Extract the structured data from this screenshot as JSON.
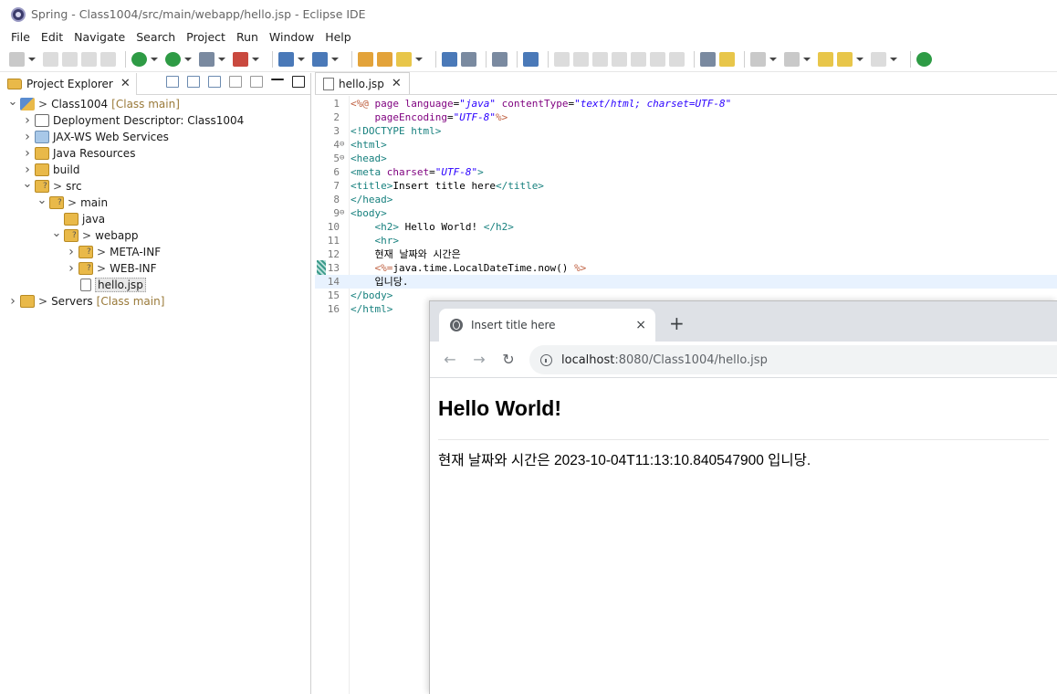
{
  "window": {
    "title": "Spring - Class1004/src/main/webapp/hello.jsp - Eclipse IDE"
  },
  "menu": [
    "File",
    "Edit",
    "Navigate",
    "Search",
    "Project",
    "Run",
    "Window",
    "Help"
  ],
  "explorer": {
    "tab_label": "Project Explorer",
    "tree": [
      {
        "depth": 0,
        "chevron": "down",
        "icon": "project",
        "prefix": ">",
        "label": "Class1004",
        "deco": "[Class main]"
      },
      {
        "depth": 1,
        "chevron": "right",
        "icon": "dd",
        "prefix": "",
        "label": "Deployment Descriptor: Class1004",
        "deco": ""
      },
      {
        "depth": 1,
        "chevron": "right",
        "icon": "ws",
        "prefix": "",
        "label": "JAX-WS Web Services",
        "deco": ""
      },
      {
        "depth": 1,
        "chevron": "right",
        "icon": "jr",
        "prefix": "",
        "label": "Java Resources",
        "deco": ""
      },
      {
        "depth": 1,
        "chevron": "right",
        "icon": "folder",
        "prefix": "",
        "label": "build",
        "deco": ""
      },
      {
        "depth": 1,
        "chevron": "down",
        "icon": "pkgfolder",
        "prefix": ">",
        "label": "src",
        "deco": ""
      },
      {
        "depth": 2,
        "chevron": "down",
        "icon": "pkgfolder",
        "prefix": ">",
        "label": "main",
        "deco": ""
      },
      {
        "depth": 3,
        "chevron": "",
        "icon": "folder",
        "prefix": "",
        "label": "java",
        "deco": ""
      },
      {
        "depth": 3,
        "chevron": "down",
        "icon": "pkgfolder",
        "prefix": ">",
        "label": "webapp",
        "deco": ""
      },
      {
        "depth": 4,
        "chevron": "right",
        "icon": "pkgfolder",
        "prefix": ">",
        "label": "META-INF",
        "deco": ""
      },
      {
        "depth": 4,
        "chevron": "right",
        "icon": "pkgfolder",
        "prefix": ">",
        "label": "WEB-INF",
        "deco": ""
      },
      {
        "depth": 4,
        "chevron": "",
        "icon": "file",
        "prefix": "",
        "label": "hello.jsp",
        "deco": "",
        "selected": true
      },
      {
        "depth": 0,
        "chevron": "right",
        "icon": "server",
        "prefix": ">",
        "label": "Servers",
        "deco": "[Class main]"
      }
    ]
  },
  "editor": {
    "tab_label": "hello.jsp",
    "current_line": 14,
    "lines": [
      {
        "n": "1",
        "fold": "",
        "html": "<span class=\"jsp\">&lt;%@</span> <span class=\"attr\">page</span> <span class=\"attr\">language</span>=<span class=\"str\">\"java\"</span> <span class=\"attr\">contentType</span>=<span class=\"str\">\"text/html; charset=UTF-8\"</span>"
      },
      {
        "n": "2",
        "fold": "",
        "html": "    <span class=\"attr\">pageEncoding</span>=<span class=\"str\">\"UTF-8\"</span><span class=\"jsp\">%&gt;</span>"
      },
      {
        "n": "3",
        "fold": "",
        "html": "<span class=\"tag\">&lt;!DOCTYPE html&gt;</span>"
      },
      {
        "n": "4",
        "fold": "⊖",
        "html": "<span class=\"tag\">&lt;html&gt;</span>"
      },
      {
        "n": "5",
        "fold": "⊖",
        "html": "<span class=\"tag\">&lt;head&gt;</span>"
      },
      {
        "n": "6",
        "fold": "",
        "html": "<span class=\"tag\">&lt;meta</span> <span class=\"attr\">charset</span>=<span class=\"str\">\"UTF-8\"</span><span class=\"tag\">&gt;</span>"
      },
      {
        "n": "7",
        "fold": "",
        "html": "<span class=\"tag\">&lt;title&gt;</span>Insert title here<span class=\"tag\">&lt;/title&gt;</span>"
      },
      {
        "n": "8",
        "fold": "",
        "html": "<span class=\"tag\">&lt;/head&gt;</span>"
      },
      {
        "n": "9",
        "fold": "⊖",
        "html": "<span class=\"tag\">&lt;body&gt;</span>"
      },
      {
        "n": "10",
        "fold": "",
        "html": "    <span class=\"tag\">&lt;h2&gt;</span> Hello World! <span class=\"tag\">&lt;/h2&gt;</span>"
      },
      {
        "n": "11",
        "fold": "",
        "html": "    <span class=\"tag\">&lt;hr&gt;</span>"
      },
      {
        "n": "12",
        "fold": "",
        "html": "    현재 날짜와 시간은"
      },
      {
        "n": "13",
        "fold": "",
        "html": "    <span class=\"jsp\">&lt;%=</span>java.time.LocalDateTime.now() <span class=\"jsp\">%&gt;</span>"
      },
      {
        "n": "14",
        "fold": "",
        "html": "    입니당."
      },
      {
        "n": "15",
        "fold": "",
        "html": "<span class=\"tag\">&lt;/body&gt;</span>"
      },
      {
        "n": "16",
        "fold": "",
        "html": "<span class=\"tag\">&lt;/html&gt;</span>"
      }
    ]
  },
  "browser": {
    "tab_title": "Insert title here",
    "tab_close": "×",
    "new_tab": "+",
    "back": "←",
    "forward": "→",
    "reload": "↻",
    "url_host": "localhost",
    "url_rest": ":8080/Class1004/hello.jsp",
    "heading": "Hello World!",
    "body_text": "현재 날짜와 시간은 2023-10-04T11:13:10.840547900 입니당."
  }
}
